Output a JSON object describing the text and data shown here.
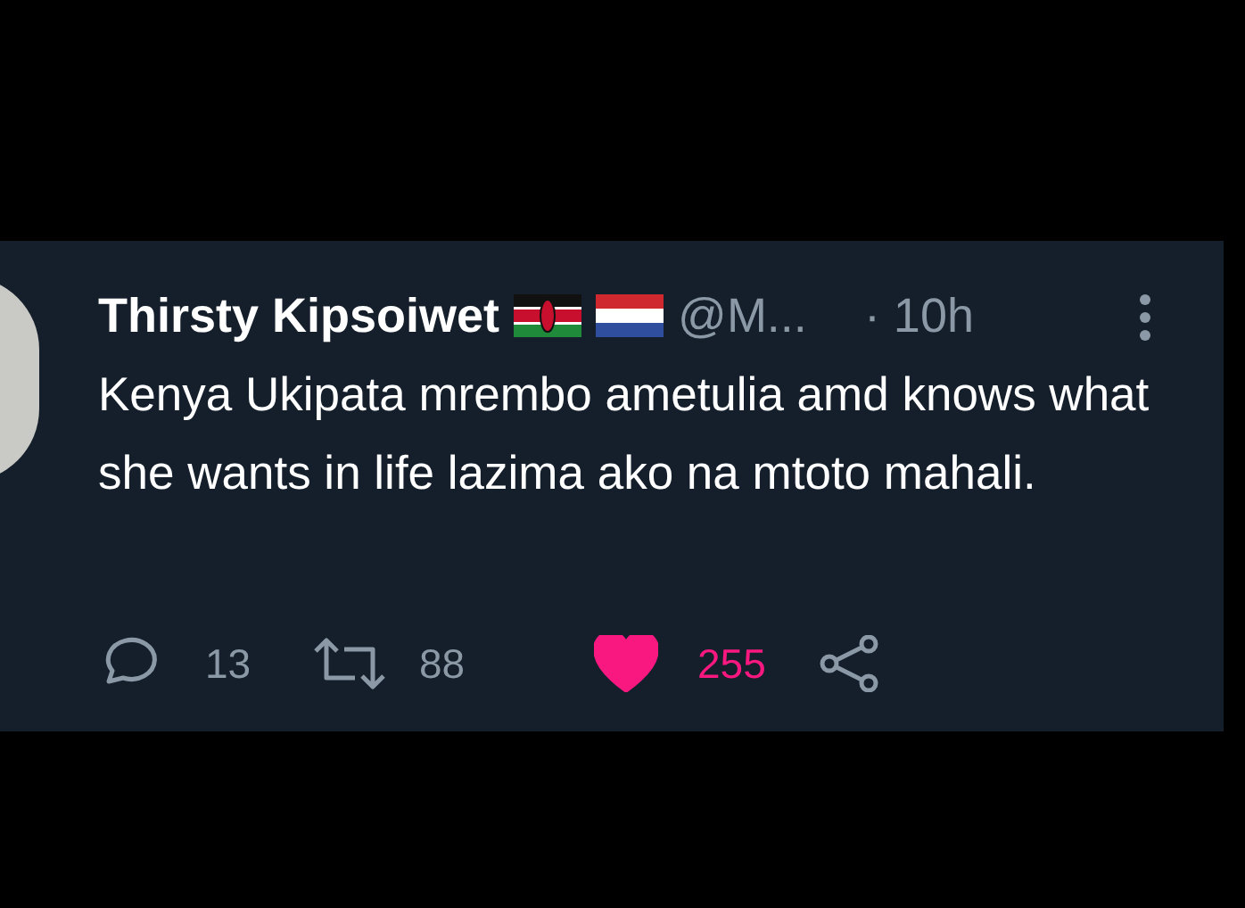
{
  "tweet": {
    "display_name": "Thirsty Kipsoiwet",
    "handle": "@M...",
    "time": "· 10h",
    "text": "Kenya Ukipata mrembo ametulia amd knows what she wants in life lazima ako na mtoto mahali.",
    "replies": "13",
    "retweets": "88",
    "likes": "255",
    "liked": true
  }
}
